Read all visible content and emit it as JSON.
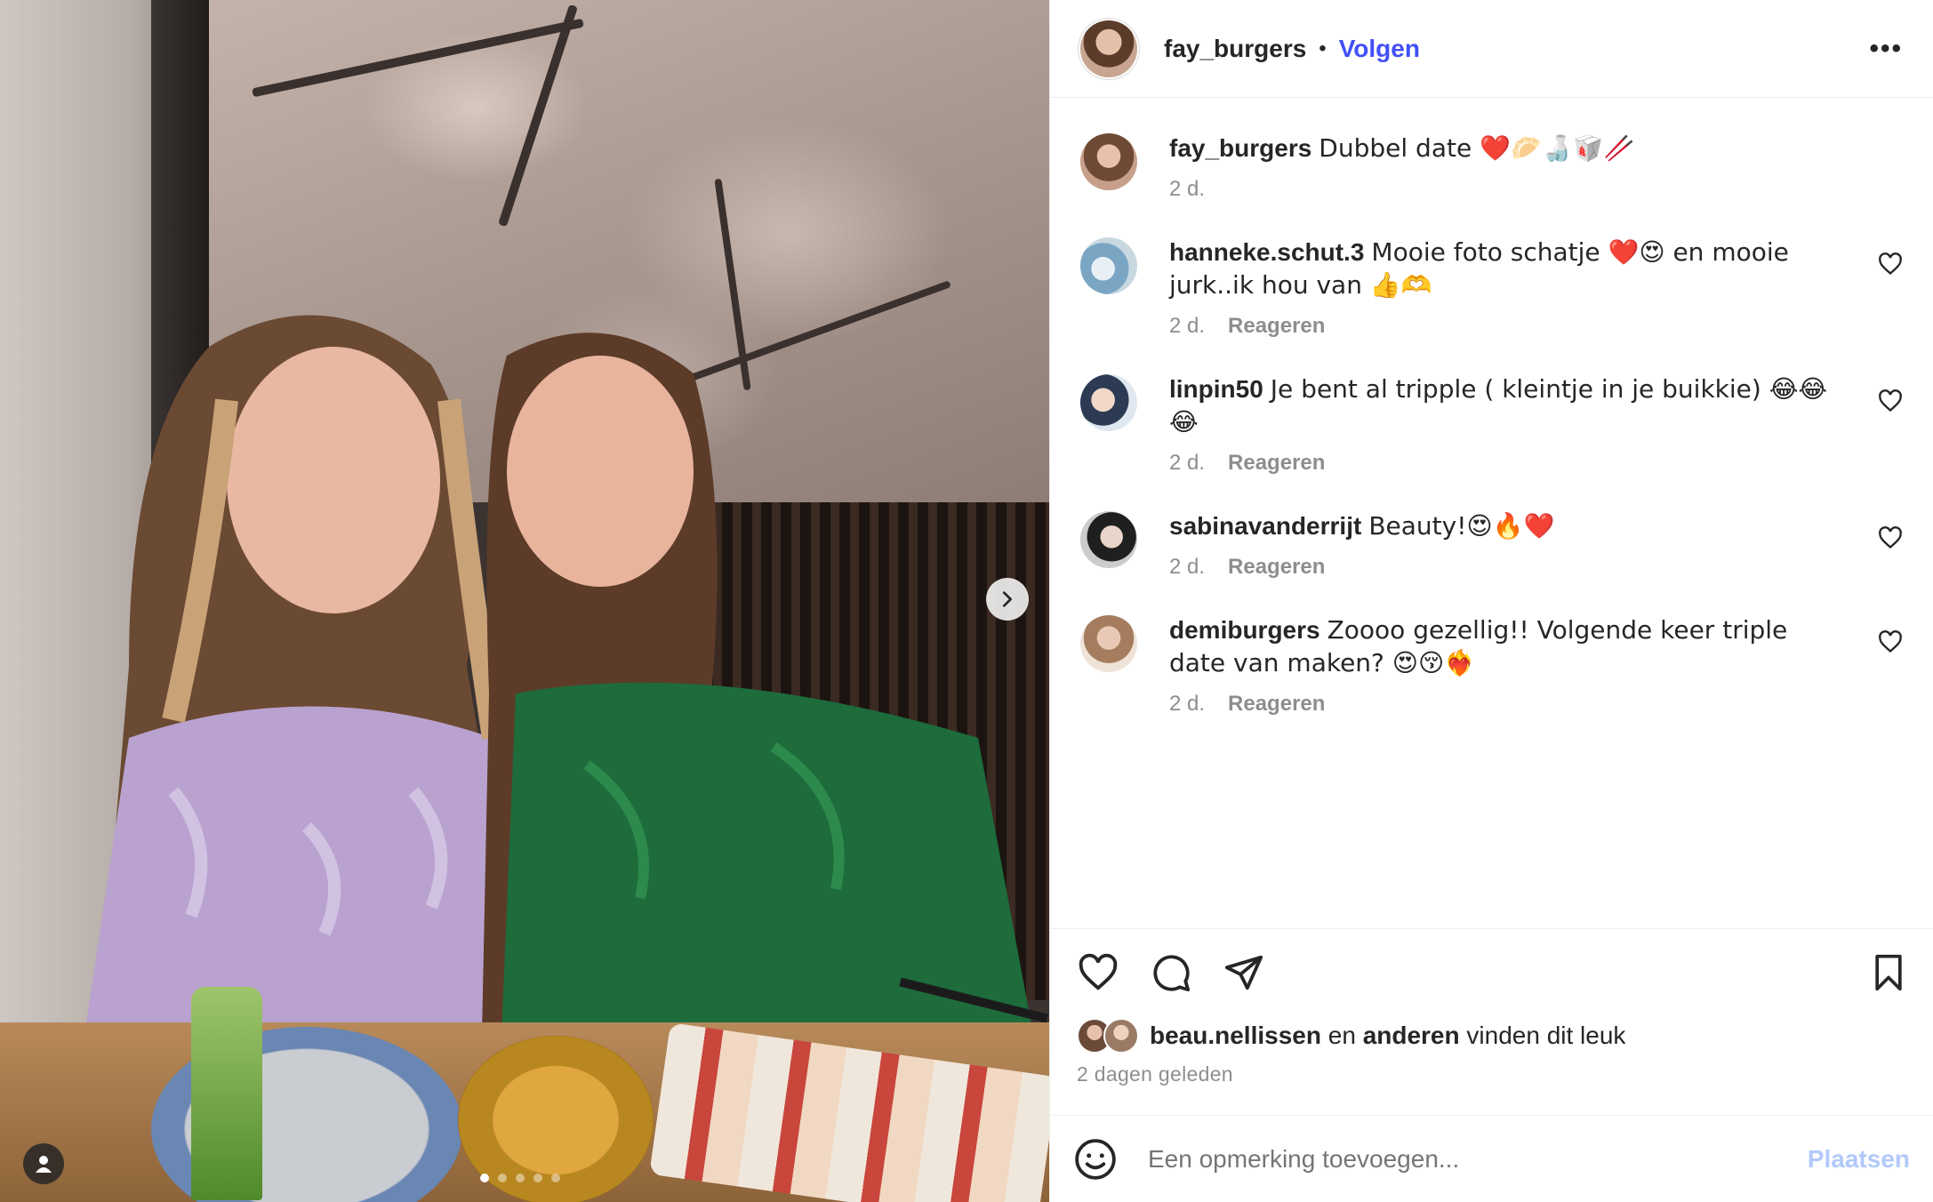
{
  "header": {
    "username": "fay_burgers",
    "separator": "•",
    "follow_label": "Volgen",
    "more_icon": "more-horizontal-icon",
    "more_label": "•••"
  },
  "caption": {
    "username": "fay_burgers",
    "text": "Dubbel date ❤️🥟🍶🥡🥢",
    "time": "2 d."
  },
  "comments": [
    {
      "username": "hanneke.schut.3",
      "text": "Mooie foto schatje ❤️😍 en mooie jurk..ik hou van 👍🫶",
      "time": "2 d.",
      "reply_label": "Reageren"
    },
    {
      "username": "linpin50",
      "text": "Je bent al tripple ( kleintje in je buikkie) 😂😂😂",
      "time": "2 d.",
      "reply_label": "Reageren"
    },
    {
      "username": "sabinavanderrijt",
      "text": "Beauty!😍🔥❤️",
      "time": "2 d.",
      "reply_label": "Reageren"
    },
    {
      "username": "demiburgers",
      "text": "Zoooo gezellig!! Volgende keer triple date van maken? 😍😚❤️‍🔥",
      "time": "2 d.",
      "reply_label": "Reageren"
    }
  ],
  "likes": {
    "first_user": "beau.nellissen",
    "connector": "en",
    "others": "anderen",
    "suffix": "vinden dit leuk"
  },
  "post_date": "2 dagen geleden",
  "add_comment": {
    "placeholder": "Een opmerking toevoegen...",
    "post_label": "Plaatsen"
  },
  "carousel": {
    "current_index": 1,
    "total": 5
  },
  "colors": {
    "follow_blue": "#4150f7",
    "post_disabled": "#b2c9fb",
    "text_primary": "#262626",
    "text_secondary": "#8e8e8e"
  }
}
